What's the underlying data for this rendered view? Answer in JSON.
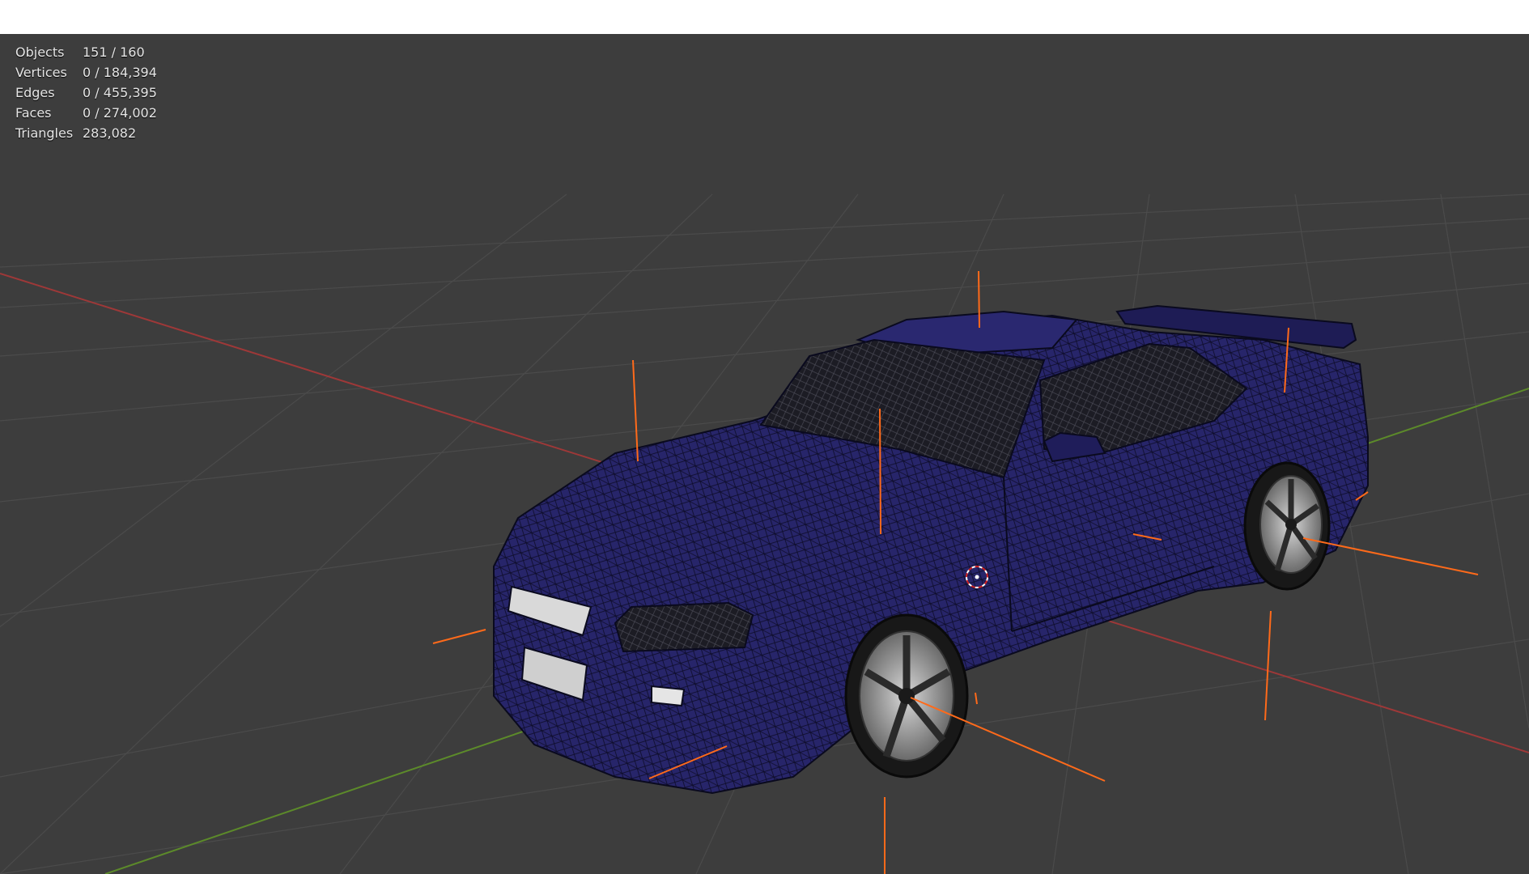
{
  "viewport": {
    "background": "#3d3d3d",
    "grid_color": "#4a4a4a",
    "axis_x_color": "#a23a3a",
    "axis_y_color": "#5f8a2c",
    "empty_color": "#ff6a1a",
    "mesh_color": "#26245e"
  },
  "stats": [
    {
      "label": "Objects",
      "value": "151 / 160"
    },
    {
      "label": "Vertices",
      "value": "0 / 184,394"
    },
    {
      "label": "Edges",
      "value": "0 / 455,395"
    },
    {
      "label": "Faces",
      "value": "0 / 274,002"
    },
    {
      "label": "Triangles",
      "value": "283,082"
    }
  ]
}
